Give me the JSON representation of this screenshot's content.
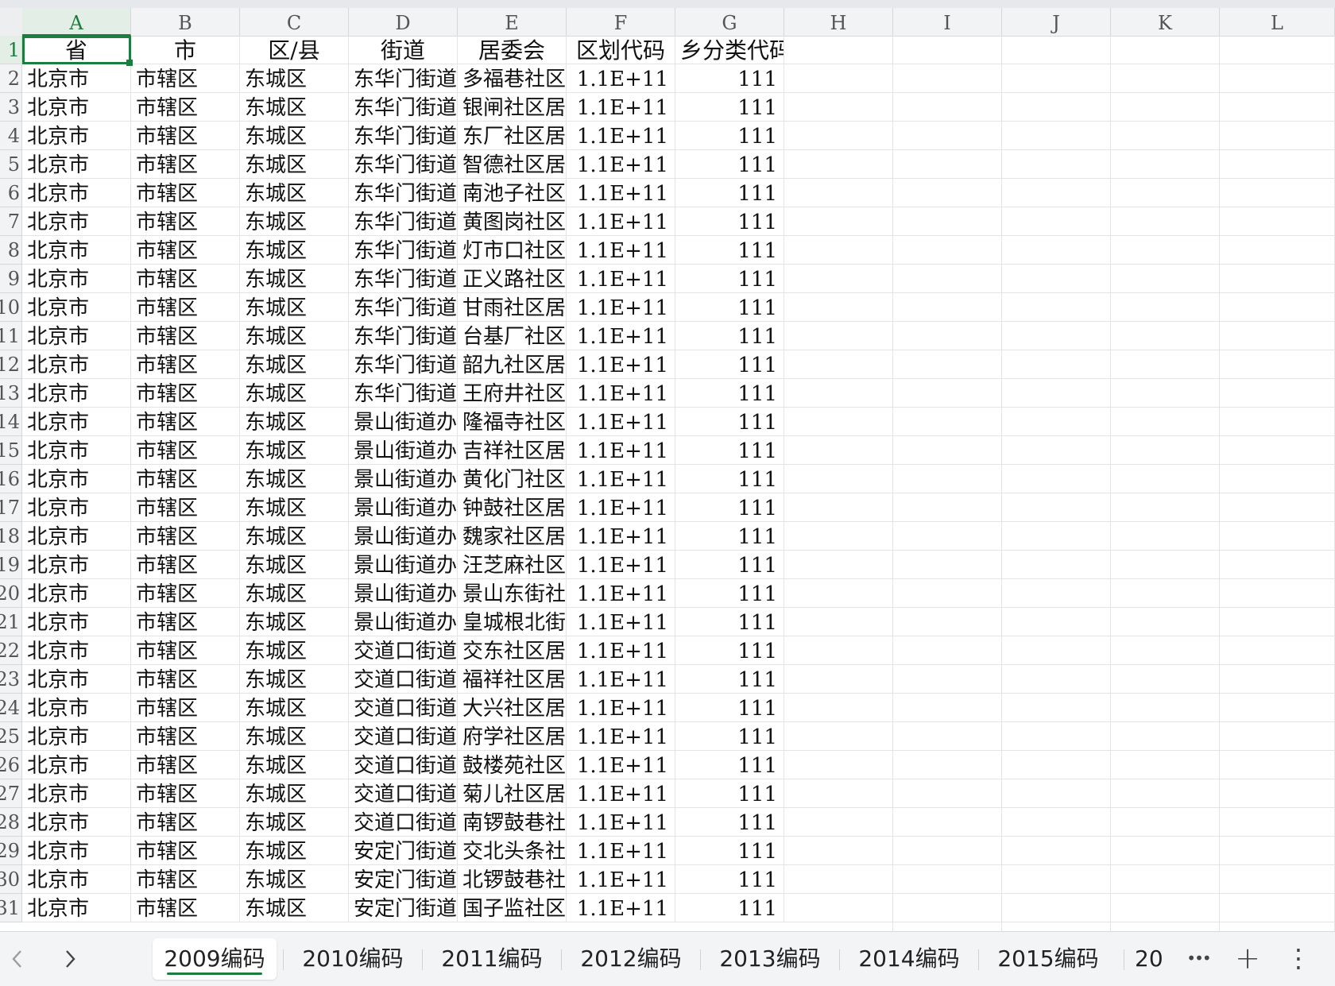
{
  "columns": [
    "A",
    "B",
    "C",
    "D",
    "E",
    "F",
    "G",
    "H",
    "I",
    "J",
    "K",
    "L"
  ],
  "header_row": {
    "num": "1",
    "cells": [
      "省",
      "市",
      "区/县",
      "街道",
      "居委会",
      "区划代码",
      "城乡分类代码"
    ],
    "g_visible": "乡分类代码"
  },
  "rows": [
    {
      "num": "2",
      "a": "北京市",
      "b": "市辖区",
      "c": "东城区",
      "d": "东华门街道",
      "e": "多福巷社区",
      "f": "1.1E+11",
      "g": "111"
    },
    {
      "num": "3",
      "a": "北京市",
      "b": "市辖区",
      "c": "东城区",
      "d": "东华门街道",
      "e": "银闸社区居",
      "f": "1.1E+11",
      "g": "111"
    },
    {
      "num": "4",
      "a": "北京市",
      "b": "市辖区",
      "c": "东城区",
      "d": "东华门街道",
      "e": "东厂社区居",
      "f": "1.1E+11",
      "g": "111"
    },
    {
      "num": "5",
      "a": "北京市",
      "b": "市辖区",
      "c": "东城区",
      "d": "东华门街道",
      "e": "智德社区居",
      "f": "1.1E+11",
      "g": "111"
    },
    {
      "num": "6",
      "a": "北京市",
      "b": "市辖区",
      "c": "东城区",
      "d": "东华门街道",
      "e": "南池子社区",
      "f": "1.1E+11",
      "g": "111"
    },
    {
      "num": "7",
      "a": "北京市",
      "b": "市辖区",
      "c": "东城区",
      "d": "东华门街道",
      "e": "黄图岗社区",
      "f": "1.1E+11",
      "g": "111"
    },
    {
      "num": "8",
      "a": "北京市",
      "b": "市辖区",
      "c": "东城区",
      "d": "东华门街道",
      "e": "灯市口社区",
      "f": "1.1E+11",
      "g": "111"
    },
    {
      "num": "9",
      "a": "北京市",
      "b": "市辖区",
      "c": "东城区",
      "d": "东华门街道",
      "e": "正义路社区",
      "f": "1.1E+11",
      "g": "111"
    },
    {
      "num": "10",
      "a": "北京市",
      "b": "市辖区",
      "c": "东城区",
      "d": "东华门街道",
      "e": "甘雨社区居",
      "f": "1.1E+11",
      "g": "111"
    },
    {
      "num": "11",
      "a": "北京市",
      "b": "市辖区",
      "c": "东城区",
      "d": "东华门街道",
      "e": "台基厂社区",
      "f": "1.1E+11",
      "g": "111"
    },
    {
      "num": "12",
      "a": "北京市",
      "b": "市辖区",
      "c": "东城区",
      "d": "东华门街道",
      "e": "韶九社区居",
      "f": "1.1E+11",
      "g": "111"
    },
    {
      "num": "13",
      "a": "北京市",
      "b": "市辖区",
      "c": "东城区",
      "d": "东华门街道",
      "e": "王府井社区",
      "f": "1.1E+11",
      "g": "111"
    },
    {
      "num": "14",
      "a": "北京市",
      "b": "市辖区",
      "c": "东城区",
      "d": "景山街道办",
      "e": "隆福寺社区",
      "f": "1.1E+11",
      "g": "111"
    },
    {
      "num": "15",
      "a": "北京市",
      "b": "市辖区",
      "c": "东城区",
      "d": "景山街道办",
      "e": "吉祥社区居",
      "f": "1.1E+11",
      "g": "111"
    },
    {
      "num": "16",
      "a": "北京市",
      "b": "市辖区",
      "c": "东城区",
      "d": "景山街道办",
      "e": "黄化门社区",
      "f": "1.1E+11",
      "g": "111"
    },
    {
      "num": "17",
      "a": "北京市",
      "b": "市辖区",
      "c": "东城区",
      "d": "景山街道办",
      "e": "钟鼓社区居",
      "f": "1.1E+11",
      "g": "111"
    },
    {
      "num": "18",
      "a": "北京市",
      "b": "市辖区",
      "c": "东城区",
      "d": "景山街道办",
      "e": "魏家社区居",
      "f": "1.1E+11",
      "g": "111"
    },
    {
      "num": "19",
      "a": "北京市",
      "b": "市辖区",
      "c": "东城区",
      "d": "景山街道办",
      "e": "汪芝麻社区",
      "f": "1.1E+11",
      "g": "111"
    },
    {
      "num": "20",
      "a": "北京市",
      "b": "市辖区",
      "c": "东城区",
      "d": "景山街道办",
      "e": "景山东街社",
      "f": "1.1E+11",
      "g": "111"
    },
    {
      "num": "21",
      "a": "北京市",
      "b": "市辖区",
      "c": "东城区",
      "d": "景山街道办",
      "e": "皇城根北街",
      "f": "1.1E+11",
      "g": "111"
    },
    {
      "num": "22",
      "a": "北京市",
      "b": "市辖区",
      "c": "东城区",
      "d": "交道口街道",
      "e": "交东社区居",
      "f": "1.1E+11",
      "g": "111"
    },
    {
      "num": "23",
      "a": "北京市",
      "b": "市辖区",
      "c": "东城区",
      "d": "交道口街道",
      "e": "福祥社区居",
      "f": "1.1E+11",
      "g": "111"
    },
    {
      "num": "24",
      "a": "北京市",
      "b": "市辖区",
      "c": "东城区",
      "d": "交道口街道",
      "e": "大兴社区居",
      "f": "1.1E+11",
      "g": "111"
    },
    {
      "num": "25",
      "a": "北京市",
      "b": "市辖区",
      "c": "东城区",
      "d": "交道口街道",
      "e": "府学社区居",
      "f": "1.1E+11",
      "g": "111"
    },
    {
      "num": "26",
      "a": "北京市",
      "b": "市辖区",
      "c": "东城区",
      "d": "交道口街道",
      "e": "鼓楼苑社区",
      "f": "1.1E+11",
      "g": "111"
    },
    {
      "num": "27",
      "a": "北京市",
      "b": "市辖区",
      "c": "东城区",
      "d": "交道口街道",
      "e": "菊儿社区居",
      "f": "1.1E+11",
      "g": "111"
    },
    {
      "num": "28",
      "a": "北京市",
      "b": "市辖区",
      "c": "东城区",
      "d": "交道口街道",
      "e": "南锣鼓巷社",
      "f": "1.1E+11",
      "g": "111"
    },
    {
      "num": "29",
      "a": "北京市",
      "b": "市辖区",
      "c": "东城区",
      "d": "安定门街道",
      "e": "交北头条社",
      "f": "1.1E+11",
      "g": "111"
    },
    {
      "num": "30",
      "a": "北京市",
      "b": "市辖区",
      "c": "东城区",
      "d": "安定门街道",
      "e": "北锣鼓巷社",
      "f": "1.1E+11",
      "g": "111"
    },
    {
      "num": "31",
      "a": "北京市",
      "b": "市辖区",
      "c": "东城区",
      "d": "安定门街道",
      "e": "国子监社区",
      "f": "1.1E+11",
      "g": "111"
    }
  ],
  "sheet_tabs": {
    "prev_icon": "chevron-left-icon",
    "next_icon": "chevron-right-icon",
    "tabs": [
      {
        "label": "2009编码",
        "active": true
      },
      {
        "label": "2010编码",
        "active": false
      },
      {
        "label": "2011编码",
        "active": false
      },
      {
        "label": "2012编码",
        "active": false
      },
      {
        "label": "2013编码",
        "active": false
      },
      {
        "label": "2014编码",
        "active": false
      },
      {
        "label": "2015编码",
        "active": false
      }
    ],
    "partial_tab": "20",
    "more_glyph": "•••",
    "add_glyph": "+",
    "menu_glyph": "⋮"
  },
  "colors": {
    "accent": "#1c7d3f",
    "header_bg": "#f2f3f5",
    "gridline": "#e3e4e6"
  }
}
